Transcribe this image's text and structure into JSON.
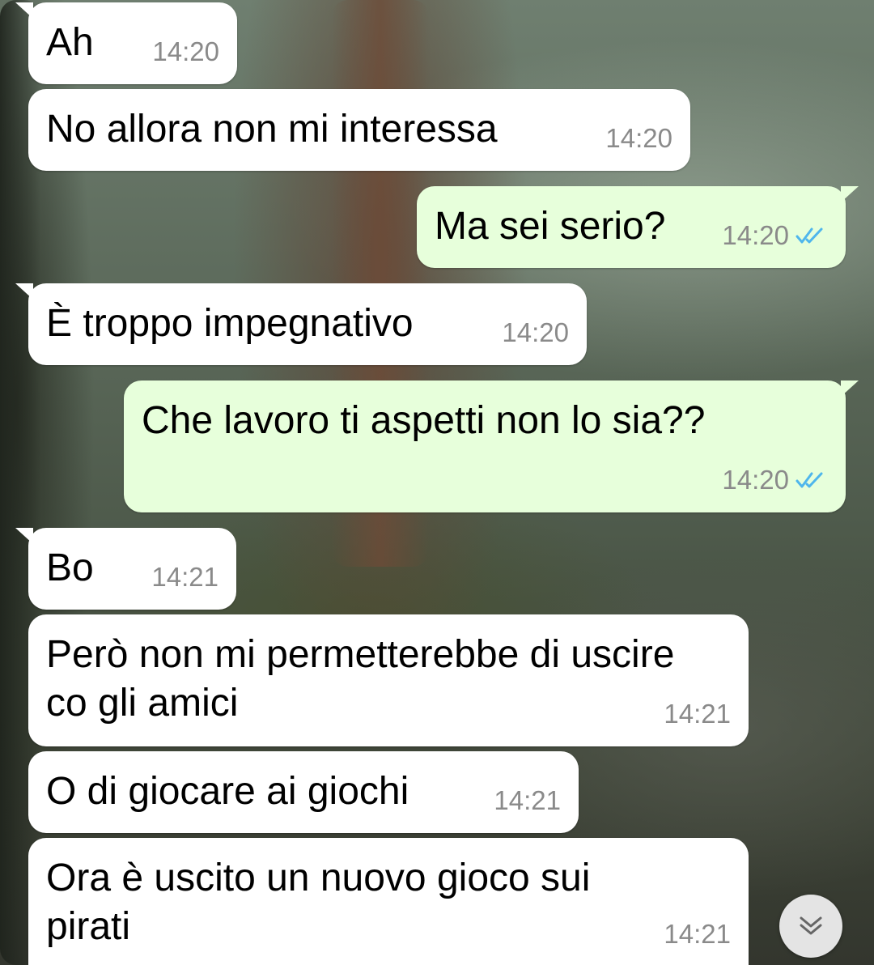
{
  "messages": [
    {
      "text": "Ah",
      "time": "14:20"
    },
    {
      "text": "No allora non mi interessa",
      "time": "14:20"
    },
    {
      "text": "Ma sei serio?",
      "time": "14:20",
      "status": "double-check-read"
    },
    {
      "text": "È troppo impegnativo",
      "time": "14:20"
    },
    {
      "text": "Che lavoro ti aspetti non lo sia??",
      "time": "14:20",
      "status": "double-check-read"
    },
    {
      "text": "Bo",
      "time": "14:21"
    },
    {
      "text_lines": [
        "Però non mi permetterebbe di uscire",
        "co gli amici"
      ],
      "time": "14:21"
    },
    {
      "text": "O di giocare ai giochi",
      "time": "14:21"
    },
    {
      "text_lines": [
        "Ora è uscito un nuovo gioco sui",
        "pirati"
      ],
      "time": "14:21"
    }
  ],
  "icons": {
    "read_receipt": "double-check-icon",
    "scroll_down": "double-chevron-down-icon"
  },
  "colors": {
    "incoming_bubble": "#ffffff",
    "outgoing_bubble": "#e7ffdb",
    "timestamp": "#8a8a8a",
    "read_ticks": "#4fb6ec"
  }
}
